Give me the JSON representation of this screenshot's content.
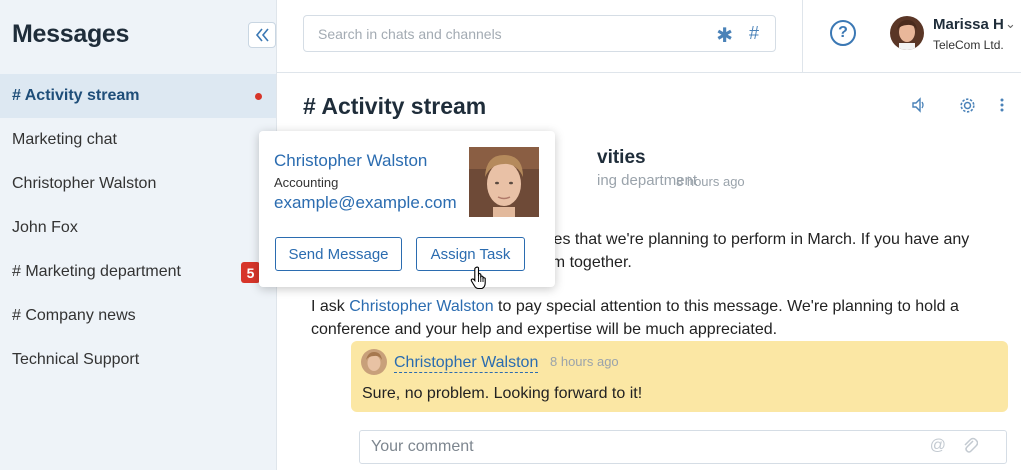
{
  "sidebar": {
    "title": "Messages",
    "items": [
      {
        "label": "# Activity stream",
        "active": true,
        "unread_dot": true
      },
      {
        "label": "Marketing chat"
      },
      {
        "label": "Christopher Walston"
      },
      {
        "label": "John Fox"
      },
      {
        "label": "# Marketing department",
        "badge": "5"
      },
      {
        "label": "# Company news"
      },
      {
        "label": "Technical Support"
      }
    ]
  },
  "header": {
    "search_placeholder": "Search in chats and channels",
    "user": {
      "name": "Marissa H",
      "org": "TeleCom Ltd."
    },
    "help_label": "?"
  },
  "main": {
    "title": "# Activity stream",
    "post": {
      "title_visible": "vities",
      "subtitle_visible": "ing department",
      "time": "8 hours ago",
      "body_line1": "vities that we're planning to perform in March. If you have any",
      "body_line2": "hem together.",
      "body2_prefix": "I ask ",
      "body2_mention": "Christopher Walston",
      "body2_suffix": " to pay special attention to this message. We're planning to hold a conference and your help and expertise will be much appreciated."
    },
    "reply": {
      "author": "Christopher Walston",
      "time": "8 hours ago",
      "text": "Sure, no problem. Looking forward to it!"
    },
    "comment_placeholder": "Your comment"
  },
  "popover": {
    "name": "Christopher Walston",
    "department": "Accounting",
    "email": "example@example.com",
    "send_button": "Send Message",
    "assign_button": "Assign Task"
  },
  "colors": {
    "accent": "#2b6cb0",
    "badge": "#d7352a",
    "reply_bg": "#fbe7a4",
    "sidebar_bg": "#eef3f8"
  }
}
